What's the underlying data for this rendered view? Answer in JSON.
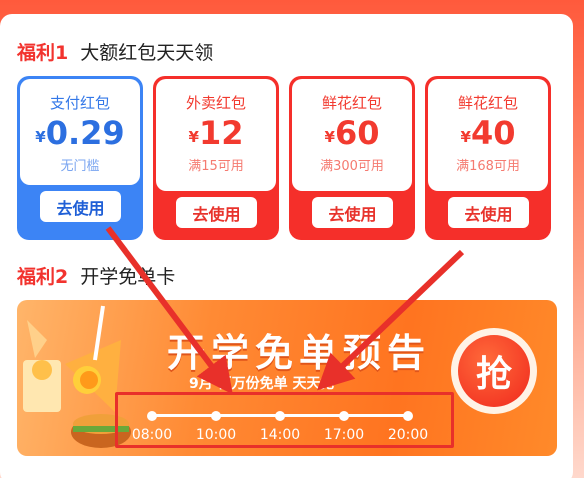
{
  "section1": {
    "tag": "福利1",
    "name": "大额红包天天领"
  },
  "cards": [
    {
      "title": "支付红包",
      "currency": "¥",
      "amount": "0.29",
      "condition": "无门槛",
      "button": "去使用",
      "theme": "#3c84f5"
    },
    {
      "title": "外卖红包",
      "currency": "¥",
      "amount": "12",
      "condition": "满15可用",
      "button": "去使用",
      "theme": "#f52f2a"
    },
    {
      "title": "鲜花红包",
      "currency": "¥",
      "amount": "60",
      "condition": "满300可用",
      "button": "去使用",
      "theme": "#f52f2a"
    },
    {
      "title": "鲜花红包",
      "currency": "¥",
      "amount": "40",
      "condition": "满168可用",
      "button": "去使用",
      "theme": "#f52f2a"
    }
  ],
  "section2": {
    "tag": "福利2",
    "name": "开学免单卡"
  },
  "banner": {
    "title": "开学免单预告",
    "subtitle": "9月 百万份免单 天天抢",
    "grab_label": "抢",
    "times": [
      "08:00",
      "10:00",
      "14:00",
      "17:00",
      "20:00"
    ]
  },
  "colors": {
    "accent_red": "#f2332e",
    "accent_blue": "#3c84f5",
    "annotation": "#e8302a"
  }
}
